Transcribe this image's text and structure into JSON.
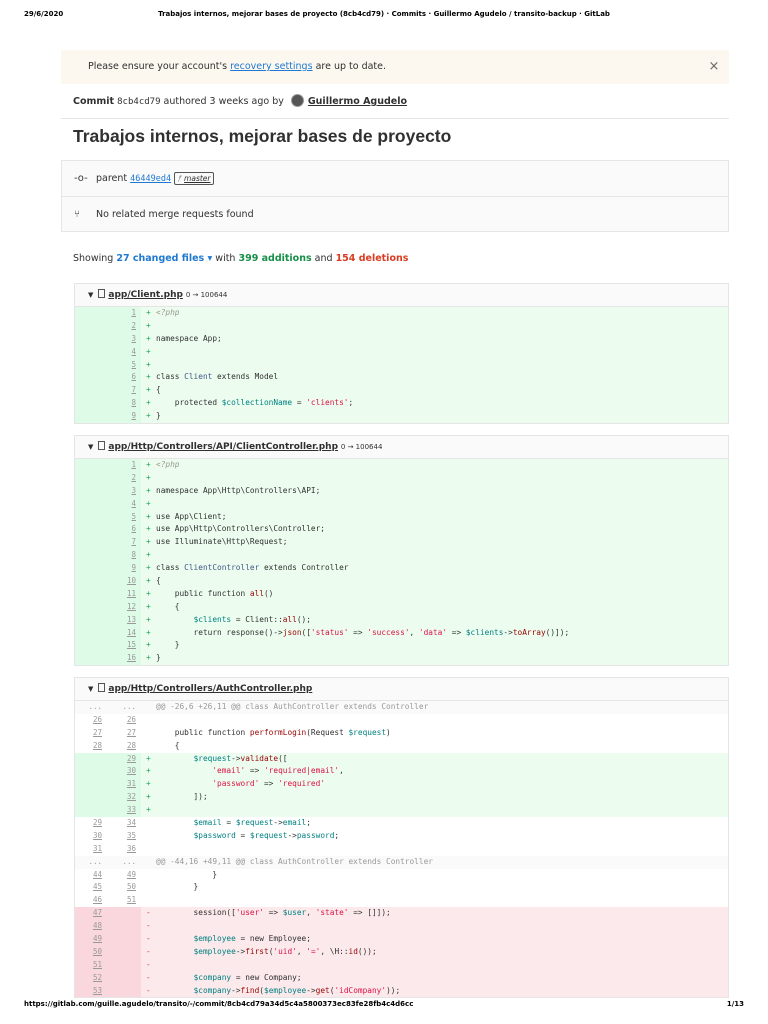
{
  "print": {
    "date": "29/6/2020",
    "title": "Trabajos internos, mejorar bases de proyecto (8cb4cd79) · Commits · Guillermo Agudelo / transito-backup · GitLab",
    "url": "https://gitlab.com/guille.agudelo/transito/-/commit/8cb4cd79a34d5c4a5800373ec83fe28fb4c4d6cc",
    "page": "1/13"
  },
  "alert": {
    "prefix": "Please ensure your account's ",
    "link": "recovery settings",
    "suffix": " are up to date.",
    "close": "×"
  },
  "commit": {
    "label": "Commit",
    "sha": "8cb4cd79",
    "authored": " authored 3 weeks ago by ",
    "author": "Guillermo Agudelo",
    "title": "Trabajos internos, mejorar bases de proyecto",
    "parent_label": "parent",
    "parent_sha": "46449ed4",
    "branch": "master",
    "merge_requests": "No related merge requests found"
  },
  "stats": {
    "showing": "Showing ",
    "files": "27 changed files",
    "with": " with ",
    "additions": "399 additions",
    "and": " and ",
    "deletions": "154 deletions"
  },
  "files": [
    {
      "path": "app/Client.php",
      "mode": "0 → 100644",
      "lines": [
        {
          "t": "add",
          "o": "",
          "n": "1",
          "h": "<span class='c'>&lt;?php</span>"
        },
        {
          "t": "add",
          "o": "",
          "n": "2",
          "h": ""
        },
        {
          "t": "add",
          "o": "",
          "n": "3",
          "h": "namespace App;"
        },
        {
          "t": "add",
          "o": "",
          "n": "4",
          "h": ""
        },
        {
          "t": "add",
          "o": "",
          "n": "5",
          "h": ""
        },
        {
          "t": "add",
          "o": "",
          "n": "6",
          "h": "class <span class='cl'>Client</span> extends Model"
        },
        {
          "t": "add",
          "o": "",
          "n": "7",
          "h": "{"
        },
        {
          "t": "add",
          "o": "",
          "n": "8",
          "h": "    protected <span class='v'>$collectionName</span> = <span class='s'>'clients'</span>;"
        },
        {
          "t": "add",
          "o": "",
          "n": "9",
          "h": "}"
        }
      ]
    },
    {
      "path": "app/Http/Controllers/API/ClientController.php",
      "mode": "0 → 100644",
      "lines": [
        {
          "t": "add",
          "o": "",
          "n": "1",
          "h": "<span class='c'>&lt;?php</span>"
        },
        {
          "t": "add",
          "o": "",
          "n": "2",
          "h": ""
        },
        {
          "t": "add",
          "o": "",
          "n": "3",
          "h": "namespace App\\Http\\Controllers\\API;"
        },
        {
          "t": "add",
          "o": "",
          "n": "4",
          "h": ""
        },
        {
          "t": "add",
          "o": "",
          "n": "5",
          "h": "use App\\Client;"
        },
        {
          "t": "add",
          "o": "",
          "n": "6",
          "h": "use App\\Http\\Controllers\\Controller;"
        },
        {
          "t": "add",
          "o": "",
          "n": "7",
          "h": "use Illuminate\\Http\\Request;"
        },
        {
          "t": "add",
          "o": "",
          "n": "8",
          "h": ""
        },
        {
          "t": "add",
          "o": "",
          "n": "9",
          "h": "class <span class='cl'>ClientController</span> extends Controller"
        },
        {
          "t": "add",
          "o": "",
          "n": "10",
          "h": "{"
        },
        {
          "t": "add",
          "o": "",
          "n": "11",
          "h": "    public function <span class='f'>all</span>()"
        },
        {
          "t": "add",
          "o": "",
          "n": "12",
          "h": "    {"
        },
        {
          "t": "add",
          "o": "",
          "n": "13",
          "h": "        <span class='v'>$clients</span> = Client::<span class='f'>all</span>();"
        },
        {
          "t": "add",
          "o": "",
          "n": "14",
          "h": "        return response()-&gt;<span class='f'>json</span>([<span class='s'>'status'</span> =&gt; <span class='s'>'success'</span>, <span class='s'>'data'</span> =&gt; <span class='v'>$clients</span>-&gt;<span class='f'>toArray</span>()]);"
        },
        {
          "t": "add",
          "o": "",
          "n": "15",
          "h": "    }"
        },
        {
          "t": "add",
          "o": "",
          "n": "16",
          "h": "}"
        }
      ]
    },
    {
      "path": "app/Http/Controllers/AuthController.php",
      "mode": "",
      "lines": [
        {
          "t": "match",
          "o": "...",
          "n": "...",
          "h": "@@ -26,6 +26,11 @@ class AuthController extends Controller"
        },
        {
          "t": "ctx",
          "o": "26",
          "n": "26",
          "h": ""
        },
        {
          "t": "ctx",
          "o": "27",
          "n": "27",
          "h": "    public function <span class='f'>performLogin</span>(Request <span class='v'>$request</span>)"
        },
        {
          "t": "ctx",
          "o": "28",
          "n": "28",
          "h": "    {"
        },
        {
          "t": "add",
          "o": "",
          "n": "29",
          "h": "        <span class='v'>$request</span>-&gt;<span class='f'>validate</span>(["
        },
        {
          "t": "add",
          "o": "",
          "n": "30",
          "h": "            <span class='s'>'email'</span> =&gt; <span class='s'>'required|email'</span>,"
        },
        {
          "t": "add",
          "o": "",
          "n": "31",
          "h": "            <span class='s'>'password'</span> =&gt; <span class='s'>'required'</span>"
        },
        {
          "t": "add",
          "o": "",
          "n": "32",
          "h": "        ]);"
        },
        {
          "t": "add",
          "o": "",
          "n": "33",
          "h": ""
        },
        {
          "t": "ctx",
          "o": "29",
          "n": "34",
          "h": "        <span class='v'>$email</span> = <span class='v'>$request</span>-&gt;<span class='v'>email</span>;"
        },
        {
          "t": "ctx",
          "o": "30",
          "n": "35",
          "h": "        <span class='v'>$password</span> = <span class='v'>$request</span>-&gt;<span class='v'>password</span>;"
        },
        {
          "t": "ctx",
          "o": "31",
          "n": "36",
          "h": ""
        },
        {
          "t": "match",
          "o": "...",
          "n": "...",
          "h": "@@ -44,16 +49,11 @@ class AuthController extends Controller"
        },
        {
          "t": "ctx",
          "o": "44",
          "n": "49",
          "h": "            }"
        },
        {
          "t": "ctx",
          "o": "45",
          "n": "50",
          "h": "        }"
        },
        {
          "t": "ctx",
          "o": "46",
          "n": "51",
          "h": ""
        },
        {
          "t": "del",
          "o": "47",
          "n": "",
          "h": "        session([<span class='s'>'user'</span> =&gt; <span class='v'>$user</span>, <span class='s'>'state'</span> =&gt; []]);"
        },
        {
          "t": "del",
          "o": "48",
          "n": "",
          "h": ""
        },
        {
          "t": "del",
          "o": "49",
          "n": "",
          "h": "        <span class='v'>$employee</span> = new Employee;"
        },
        {
          "t": "del",
          "o": "50",
          "n": "",
          "h": "        <span class='v'>$employee</span>-&gt;<span class='f'>first</span>(<span class='s'>'uid'</span>, <span class='s'>'='</span>, \\H::<span class='f'>id</span>());"
        },
        {
          "t": "del",
          "o": "51",
          "n": "",
          "h": ""
        },
        {
          "t": "del",
          "o": "52",
          "n": "",
          "h": "        <span class='v'>$company</span> = new Company;"
        },
        {
          "t": "del",
          "o": "53",
          "n": "",
          "h": "        <span class='v'>$company</span>-&gt;<span class='f'>find</span>(<span class='v'>$employee</span>-&gt;<span class='f'>get</span>(<span class='s'>'idCompany'</span>));"
        }
      ]
    }
  ]
}
